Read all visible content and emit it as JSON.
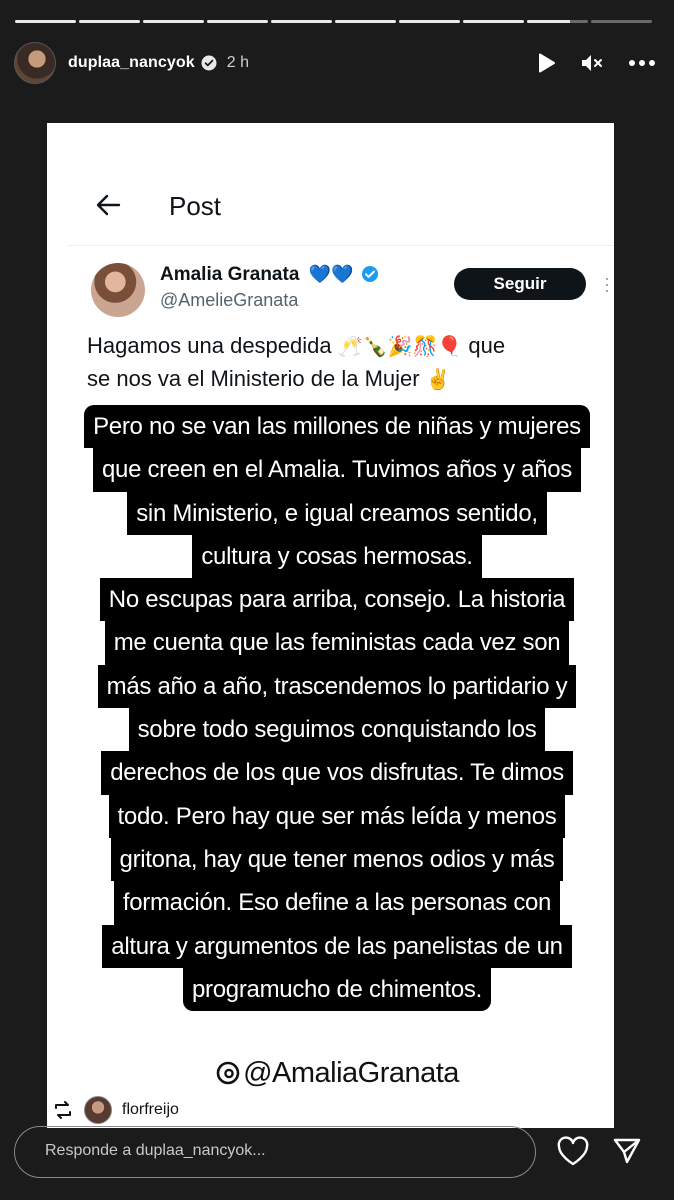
{
  "story": {
    "segments_total": 10,
    "segments_completed": 8,
    "current_segment_progress": 0.7,
    "username": "duplaa_nancyok",
    "time": "2 h"
  },
  "post": {
    "header_title": "Post",
    "author_name": "Amalia Granata",
    "author_badges": "💙💙",
    "author_handle": "@AmelieGranata",
    "follow_label": "Seguir",
    "text_line1": "Hagamos una despedida",
    "text_emojis": "🥂🍾🎉🎊🎈",
    "text_line1_end": "que",
    "text_line2": "se nos va el Ministerio de la Mujer",
    "text_line2_emoji": "✌️"
  },
  "overlay": {
    "lines": [
      "Pero no se van las millones de niñas y mujeres",
      "que creen en el Amalia. Tuvimos años y años",
      "sin Ministerio, e igual creamos sentido,",
      "cultura y cosas hermosas.",
      "No escupas para arriba, consejo.  La historia",
      "me cuenta que las feministas cada vez son",
      "más año a año, trascendemos lo partidario y",
      "sobre todo  seguimos conquistando los",
      "derechos de los que vos disfrutas.  Te dimos",
      "todo. Pero hay que ser más leída y menos",
      "gritona, hay que tener menos odios y más",
      "formación. Eso define a las personas con",
      "altura y argumentos de las panelistas de un",
      "programucho de chimentos."
    ]
  },
  "mention": "@AmaliaGranata",
  "repost": {
    "name": "florfreijo"
  },
  "reply": {
    "placeholder": "Responde a duplaa_nancyok..."
  },
  "colors": {
    "background": "#1b1b1b",
    "overlay_bg": "#000000",
    "follow_button": "#0f1419",
    "heart_blue": "#1e63d8"
  },
  "icons": {
    "play": "play-icon",
    "mute": "mute-icon",
    "more": "more-icon",
    "heart": "heart-icon",
    "send": "send-icon",
    "repost": "repost-icon",
    "threads": "threads-icon"
  }
}
